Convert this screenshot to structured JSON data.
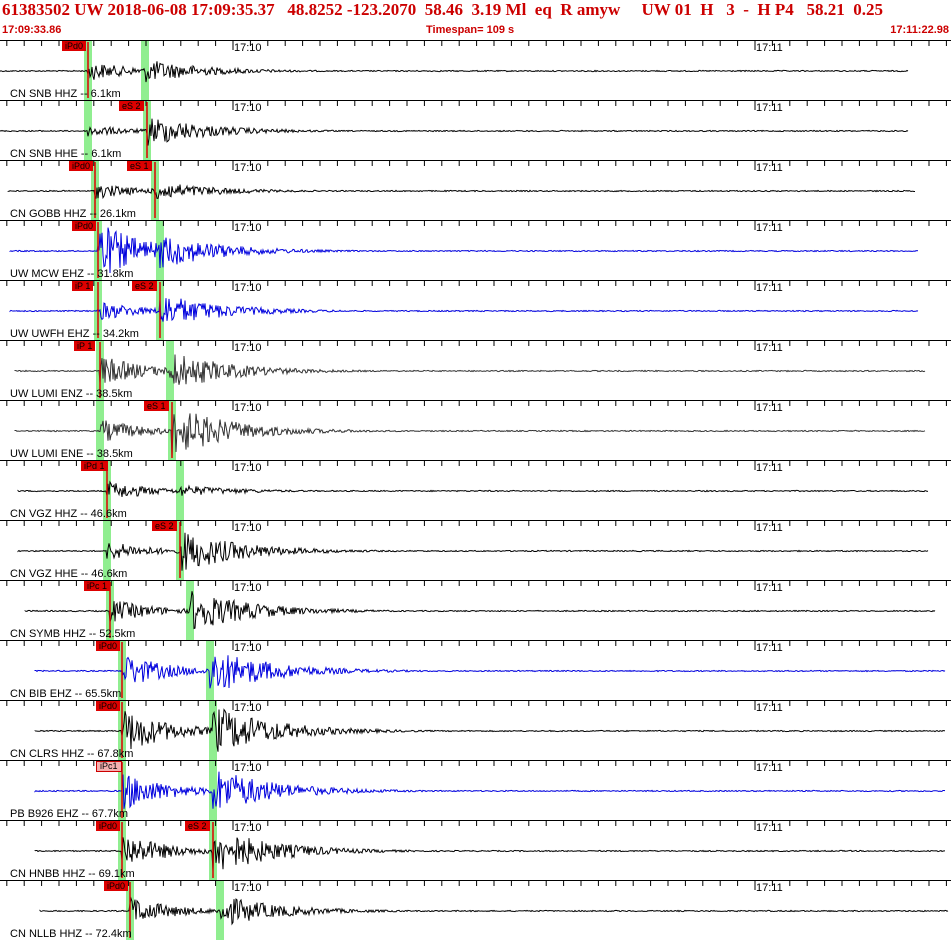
{
  "header": {
    "title": "61383502 UW 2018-06-08 17:09:35.37   48.8252 -123.2070  58.46  3.19 Ml  eq  R amyw     UW 01  H   3  -  H P4   58.21  0.25",
    "start_time": "17:09:33.86",
    "timespan": "Timespan= 109 s",
    "end_time": "17:11:22.98"
  },
  "tick_labels": [
    "17:10",
    "17:11"
  ],
  "colors": {
    "black_trace": "#000000",
    "blue_trace": "#0000dd",
    "gray_trace": "#333333",
    "pick": "#dd0000",
    "window": "#90ee90",
    "title": "#cc0000"
  },
  "channels": [
    {
      "label": "CN SNB HHZ -- 6.1km",
      "color": "#000000",
      "p_pick": "iPd0",
      "s_pick": "",
      "p_light": false
    },
    {
      "label": "CN SNB HHE -- 6.1km",
      "color": "#000000",
      "p_pick": "",
      "s_pick": "eS 2",
      "p_light": false
    },
    {
      "label": "CN GOBB HHZ -- 26.1km",
      "color": "#000000",
      "p_pick": "iPd0",
      "s_pick": "eS 1",
      "p_light": false
    },
    {
      "label": "UW MCW EHZ -- 31.8km",
      "color": "#0000dd",
      "p_pick": "iPd0",
      "s_pick": "",
      "p_light": false
    },
    {
      "label": "UW UWFH EHZ -- 34.2km",
      "color": "#0000dd",
      "p_pick": "iP 1",
      "s_pick": "eS 2",
      "p_light": false
    },
    {
      "label": "UW LUMI ENZ -- 38.5km",
      "color": "#333333",
      "p_pick": "iP 1",
      "s_pick": "",
      "p_light": false
    },
    {
      "label": "UW LUMI ENE -- 38.5km",
      "color": "#333333",
      "p_pick": "",
      "s_pick": "eS 1",
      "p_light": false
    },
    {
      "label": "CN VGZ HHZ -- 46.6km",
      "color": "#000000",
      "p_pick": "iPd 1",
      "s_pick": "",
      "p_light": false
    },
    {
      "label": "CN VGZ HHE -- 46.6km",
      "color": "#000000",
      "p_pick": "",
      "s_pick": "eS 2",
      "p_light": false
    },
    {
      "label": "CN SYMB HHZ -- 52.5km",
      "color": "#000000",
      "p_pick": "iPc 1",
      "s_pick": "",
      "p_light": false
    },
    {
      "label": "CN BIB EHZ -- 65.5km",
      "color": "#0000dd",
      "p_pick": "iPd0",
      "s_pick": "",
      "p_light": false
    },
    {
      "label": "CN CLRS HHZ -- 67.8km",
      "color": "#000000",
      "p_pick": "iPd0",
      "s_pick": "",
      "p_light": false
    },
    {
      "label": "PB B926 EHZ -- 67.7km",
      "color": "#0000dd",
      "p_pick": "iPc1",
      "s_pick": "",
      "p_light": true
    },
    {
      "label": "CN HNBB HHZ -- 69.1km",
      "color": "#000000",
      "p_pick": "iPd0",
      "s_pick": "eS 2",
      "p_light": false
    },
    {
      "label": "CN NLLB HHZ -- 72.4km",
      "color": "#000000",
      "p_pick": "iPd0",
      "s_pick": "",
      "p_light": false
    }
  ]
}
